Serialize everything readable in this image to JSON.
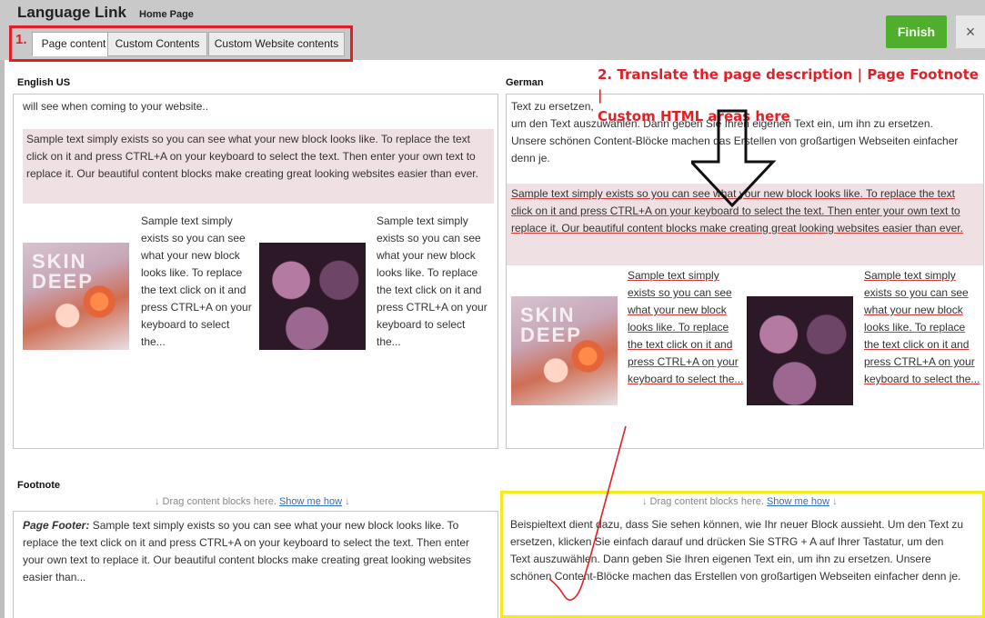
{
  "header": {
    "app_title": "Language Link",
    "page_name": "Home Page",
    "tabs": [
      {
        "label": "Page content"
      },
      {
        "label": "Custom Contents"
      },
      {
        "label": "Custom Website contents"
      }
    ],
    "finish_label": "Finish",
    "close_label": "×"
  },
  "annotations": {
    "step1": "1.",
    "step2_line1": "2. Translate the page description | Page Footnote |",
    "step2_line2": "Custom HTML areas here"
  },
  "english": {
    "label": "English US",
    "intro": "will see when coming to your website..",
    "block": "Sample text simply exists so you can see what your new block looks like. To replace the text click on it and press CTRL+A on your keyboard to select the text. Then enter your own text to replace it. Our beautiful content blocks make creating great looking websites easier than ever.",
    "tile1_text": "Sample text simply exists so you can see what your new block looks like. To replace the text click on it and press CTRL+A on your keyboard to select the...",
    "tile2_text": "Sample text simply exists so you can see what your new block looks like. To replace the text click on it and press CTRL+A on your keyboard to select the..."
  },
  "german": {
    "label": "German",
    "intro_line1": "Text zu ersetzen,",
    "intro_rest": "um den Text auszuwählen. Dann geben Sie Ihren eigenen Text ein, um ihn zu ersetzen. Unsere schönen Content-Blöcke machen das Erstellen von großartigen Webseiten einfacher denn je.",
    "block": "Sample text simply exists so you can see what your new block looks like. To replace the text click on it and press CTRL+A on your keyboard to select the text. Then enter your own text to replace it. Our beautiful content blocks make creating great looking websites easier than ever.",
    "tile1_text": "Sample text simply exists so you can see what your new block looks like. To replace the text click on it and press CTRL+A on your keyboard to select the...",
    "tile2_text": "Sample text simply exists so you can see what your new block looks like. To replace the text click on it and press CTRL+A on your keyboard to select the..."
  },
  "images": {
    "skin_deep_text": "SKIN DEEP"
  },
  "footnote": {
    "label": "Footnote",
    "drag_hint": "↓  Drag content blocks here.",
    "show_me_how": "Show me how",
    "drag_arrow": "↓",
    "english_title": "Page Footer:",
    "english_text": "Sample text simply exists so you can see what your new block looks like. To replace the text click on it and press CTRL+A on your keyboard to select the text. Then enter your own text to replace it. Our beautiful content blocks make creating great looking websites easier than...",
    "german_text": "Beispieltext dient dazu, dass Sie sehen können, wie Ihr neuer Block aussieht. Um den Text zu ersetzen, klicken Sie einfach darauf und drücken Sie STRG + A auf Ihrer Tastatur, um den Text auszuwählen. Dann geben Sie Ihren eigenen Text ein, um ihn zu ersetzen. Unsere schönen Content-Blöcke machen das Erstellen von großartigen Webseiten einfacher denn je."
  },
  "colors": {
    "highlight_red": "#e21f26",
    "finish_green": "#4fae2c",
    "footnote_highlight_yellow": "#f4eb1d",
    "block_pink": "#efe0e4",
    "link_blue": "#2f6dc4"
  }
}
